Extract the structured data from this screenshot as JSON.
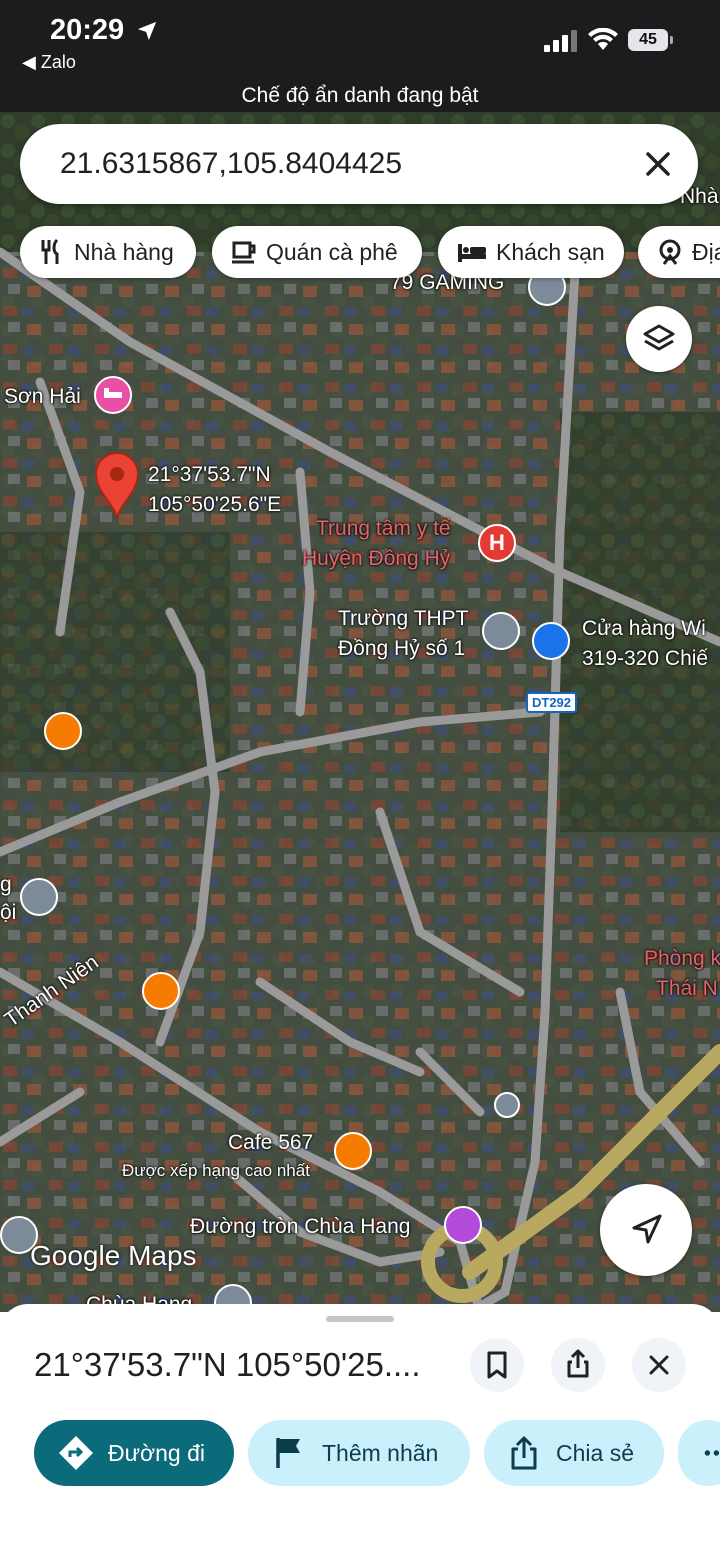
{
  "status_bar": {
    "time": "20:29",
    "back_app": "◀ Zalo",
    "battery": "45"
  },
  "incognito_banner": "Chế độ ẩn danh đang bật",
  "search": {
    "value": "21.6315867,105.8404425"
  },
  "chips": [
    {
      "label": "Nhà hàng",
      "icon": "fork-knife-icon"
    },
    {
      "label": "Quán cà phê",
      "icon": "coffee-icon"
    },
    {
      "label": "Khách sạn",
      "icon": "bed-icon"
    },
    {
      "label": "Địa",
      "icon": "attraction-icon"
    }
  ],
  "map": {
    "pin_label_lat": "21°37'53.7\"N",
    "pin_label_lng": "105°50'25.6\"E",
    "places": {
      "gaming": "79 GAMING",
      "son_hai": "Sơn Hải",
      "hospital_1": "Trung tâm y tế",
      "hospital_2": "Huyện Đồng Hỷ",
      "school_1": "Trường THPT",
      "school_2": "Đồng Hỷ số 1",
      "store_1": "Cửa hàng Wi",
      "store_2": "319-320 Chiế",
      "road_shield": "DT292",
      "clinic_1": "Phòng kha",
      "clinic_2": "Thái N",
      "road_name": "Thanh Niên",
      "cafe": "Cafe 567",
      "cafe_sub": "Được xếp hạng cao nhất",
      "roundabout": "Đường tròn Chùa Hang",
      "chua_hang": "Chùa Hang",
      "top_right": "Nhà",
      "left_edge_1": "g",
      "left_edge_2": "ội"
    },
    "logo": "Google Maps"
  },
  "sheet": {
    "title": "21°37'53.7\"N 105°50'25....",
    "actions": [
      {
        "label": "Đường đi",
        "icon": "directions-icon"
      },
      {
        "label": "Thêm nhãn",
        "icon": "flag-icon"
      },
      {
        "label": "Chia sẻ",
        "icon": "share-icon"
      }
    ]
  },
  "colors": {
    "primary": "#0b6b7b",
    "secondary": "#c9f0fb",
    "pin": "#ea4335"
  }
}
